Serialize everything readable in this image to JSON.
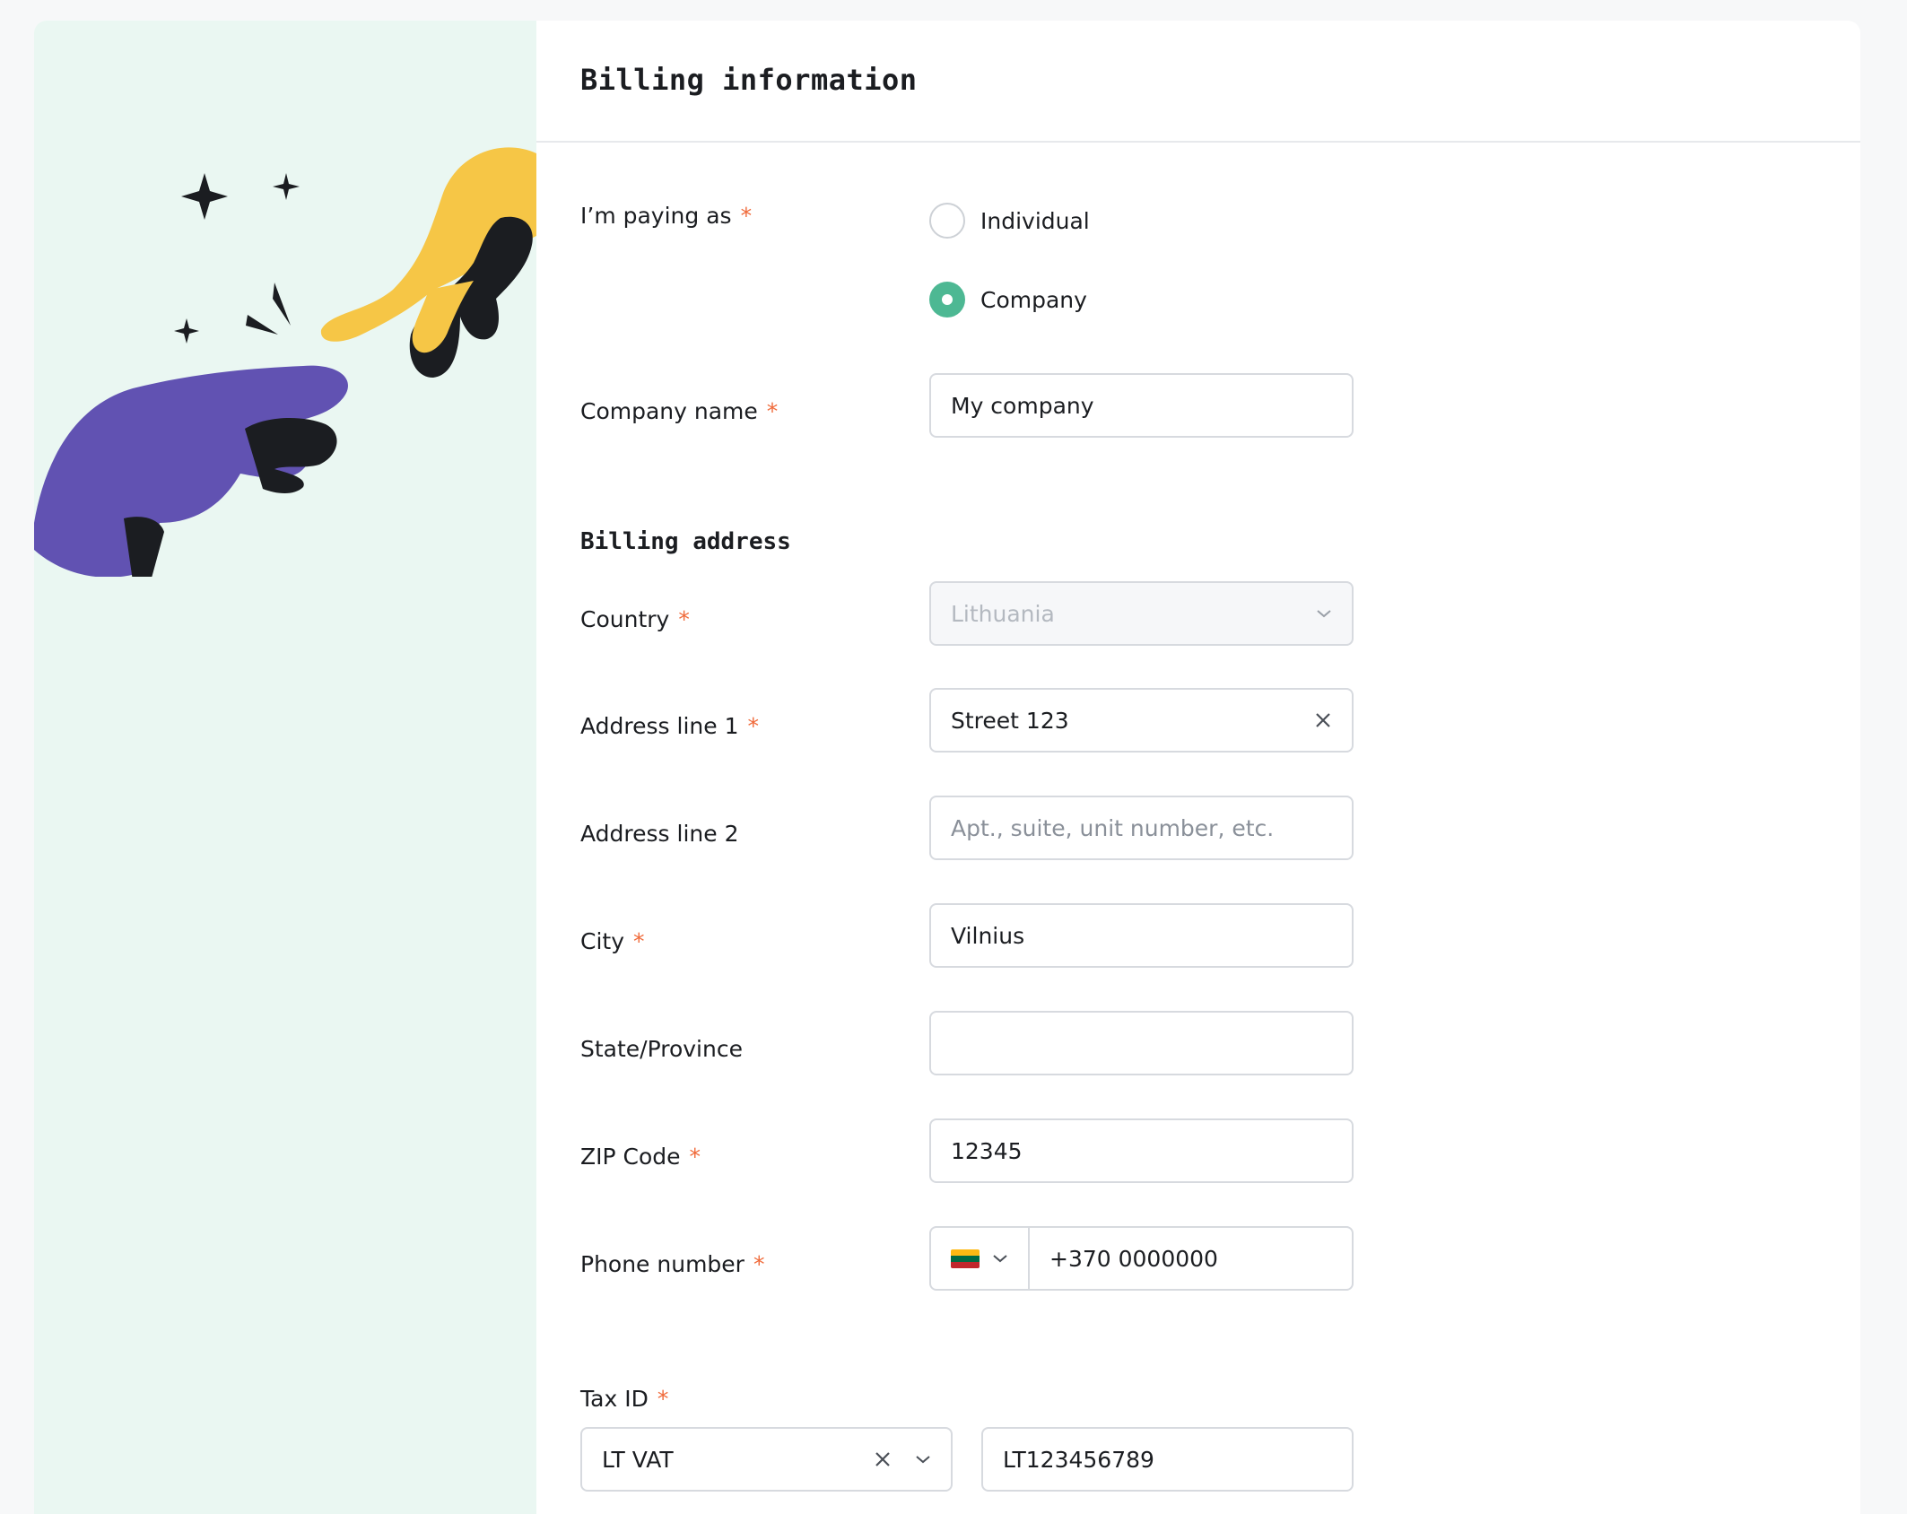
{
  "header": {
    "title": "Billing information"
  },
  "paying_as": {
    "label": "I’m paying as",
    "required_mark": "*",
    "options": [
      {
        "label": "Individual",
        "checked": false
      },
      {
        "label": "Company",
        "checked": true
      }
    ]
  },
  "company_name": {
    "label": "Company name",
    "required_mark": "*",
    "value": "My company"
  },
  "billing_address": {
    "title": "Billing address"
  },
  "country": {
    "label": "Country",
    "required_mark": "*",
    "value": "Lithuania",
    "disabled": true
  },
  "address1": {
    "label": "Address line 1",
    "required_mark": "*",
    "value": "Street 123"
  },
  "address2": {
    "label": "Address line 2",
    "placeholder": "Apt., suite, unit number, etc."
  },
  "city": {
    "label": "City",
    "required_mark": "*",
    "value": "Vilnius"
  },
  "state": {
    "label": "State/Province",
    "value": ""
  },
  "zip": {
    "label": "ZIP Code",
    "required_mark": "*",
    "value": "12345"
  },
  "phone": {
    "label": "Phone number",
    "required_mark": "*",
    "country_flag": "lithuania-flag",
    "value": "+370 0000000"
  },
  "tax_id": {
    "label": "Tax ID",
    "required_mark": "*",
    "type_value": "LT VAT",
    "number_value": "LT123456789"
  },
  "colors": {
    "accent": "#4db893",
    "required": "#f06a3a",
    "illustration_bg": "#eaf7f2",
    "flag": [
      "#fdb913",
      "#006a44",
      "#c1272d"
    ]
  }
}
